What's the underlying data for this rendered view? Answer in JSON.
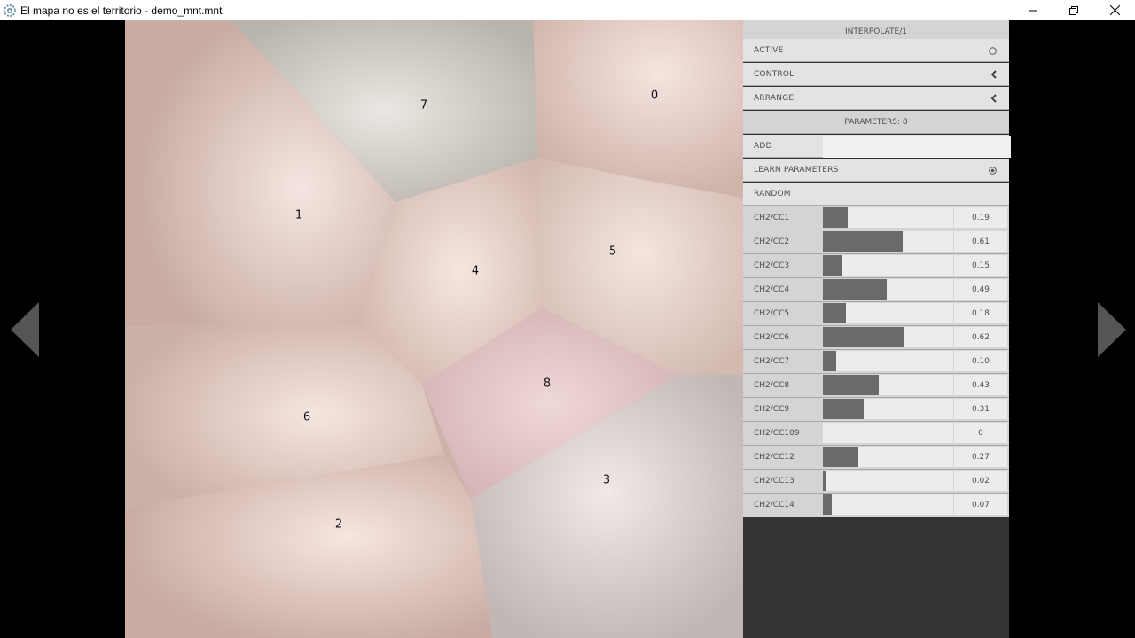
{
  "window": {
    "title": "El mapa no es el territorio - demo_mnt.mnt"
  },
  "map": {
    "nodes": [
      "0",
      "1",
      "2",
      "3",
      "4",
      "5",
      "6",
      "7",
      "8"
    ]
  },
  "panel": {
    "header": "INTERPOLATE/1",
    "active_label": "ACTIVE",
    "control_label": "CONTROL",
    "arrange_label": "ARRANGE",
    "parameters_label": "PARAMETERS: 8",
    "add_label": "ADD",
    "add_value": "",
    "learn_label": "LEARN PARAMETERS",
    "random_label": "RANDOM",
    "params": [
      {
        "name": "CH2/CC1",
        "value": 0.19,
        "display": "0.19"
      },
      {
        "name": "CH2/CC2",
        "value": 0.61,
        "display": "0.61"
      },
      {
        "name": "CH2/CC3",
        "value": 0.15,
        "display": "0.15"
      },
      {
        "name": "CH2/CC4",
        "value": 0.49,
        "display": "0.49"
      },
      {
        "name": "CH2/CC5",
        "value": 0.18,
        "display": "0.18"
      },
      {
        "name": "CH2/CC6",
        "value": 0.62,
        "display": "0.62"
      },
      {
        "name": "CH2/CC7",
        "value": 0.1,
        "display": "0.10"
      },
      {
        "name": "CH2/CC8",
        "value": 0.43,
        "display": "0.43"
      },
      {
        "name": "CH2/CC9",
        "value": 0.31,
        "display": "0.31"
      },
      {
        "name": "CH2/CC109",
        "value": 0,
        "display": "0"
      },
      {
        "name": "CH2/CC12",
        "value": 0.27,
        "display": "0.27"
      },
      {
        "name": "CH2/CC13",
        "value": 0.02,
        "display": "0.02"
      },
      {
        "name": "CH2/CC14",
        "value": 0.07,
        "display": "0.07"
      }
    ]
  },
  "colors": {
    "accent_fill": "#6a6a6a",
    "panel_bg": "#333333",
    "row_bg": "#e3e3e3"
  }
}
